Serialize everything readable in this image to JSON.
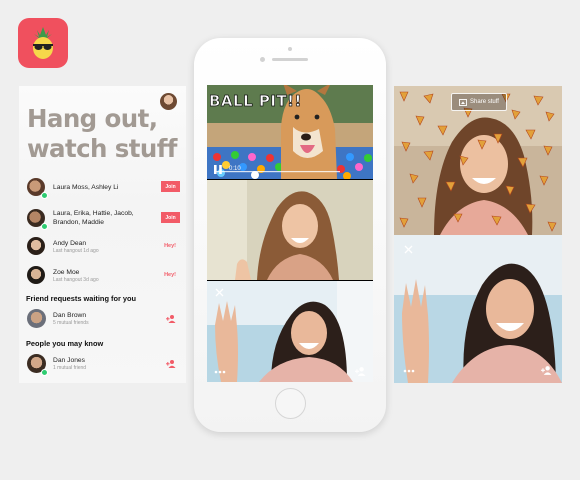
{
  "colors": {
    "accent": "#f25b67",
    "brand": "#f0505e",
    "online": "#2ecc71"
  },
  "app_icon": {
    "icon": "pineapple-sunglasses-icon"
  },
  "left_panel": {
    "title_line1": "Hang out,",
    "title_line2": "watch stuff",
    "hangouts": [
      {
        "name": "Laura Moss, Ashley Li",
        "action": "Join"
      },
      {
        "name": "Laura, Erika, Hattie, Jacob, Brandon, Maddie",
        "action": "Join"
      },
      {
        "name": "Andy Dean",
        "sub": "Last hangout 1d ago",
        "action": "Hey!"
      },
      {
        "name": "Zoe Moe",
        "sub": "Last hangout 3d ago",
        "action": "Hey!"
      }
    ],
    "friend_requests_title": "Friend requests waiting for you",
    "friend_request": {
      "name": "Dan Brown",
      "sub": "5 mutual friends"
    },
    "people_title": "People you may know",
    "suggestion": {
      "name": "Dan Jones",
      "sub": "1 mutual friend"
    }
  },
  "phone": {
    "video_caption": "BALL PIT!!",
    "video_time": "0:10",
    "icons": [
      "pause-icon",
      "close-icon",
      "more-icon",
      "add-friend-icon"
    ]
  },
  "right_panel": {
    "share_label": "Share stuff",
    "icons": [
      "share-screen-icon",
      "close-icon",
      "more-icon",
      "add-friend-icon"
    ]
  }
}
